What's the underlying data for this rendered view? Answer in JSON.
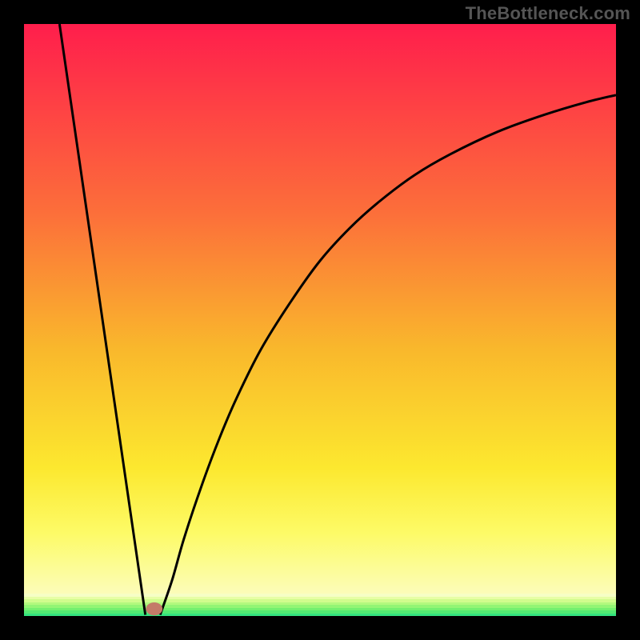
{
  "watermark": "TheBottleneck.com",
  "chart_data": {
    "type": "line",
    "title": "",
    "xlabel": "",
    "ylabel": "",
    "xlim": [
      0,
      100
    ],
    "ylim": [
      0,
      100
    ],
    "grid": false,
    "legend": false,
    "gradient_stops": [
      {
        "pos": 0,
        "color": "#FF1E4C"
      },
      {
        "pos": 32,
        "color": "#FC6F3A"
      },
      {
        "pos": 55,
        "color": "#F9B82C"
      },
      {
        "pos": 75,
        "color": "#FCE82F"
      },
      {
        "pos": 86,
        "color": "#FDFB67"
      },
      {
        "pos": 100,
        "color": "#FBFDD7"
      }
    ],
    "bottom_band_colors": [
      "#F6FEC5",
      "#E7FEA5",
      "#D1FC8D",
      "#B3F97E",
      "#93F574",
      "#73F06F",
      "#52EA73",
      "#34E37F"
    ],
    "marker": {
      "x": 22,
      "y": 1.2,
      "color": "#C47B69"
    },
    "series": [
      {
        "name": "left-segment",
        "x": [
          6,
          20.5
        ],
        "y": [
          100,
          0.2
        ]
      },
      {
        "name": "right-curve",
        "x": [
          23,
          25,
          27,
          30,
          33,
          36,
          40,
          45,
          50,
          55,
          60,
          66,
          72,
          80,
          88,
          95,
          100
        ],
        "y": [
          0.2,
          6,
          13,
          22,
          30,
          37,
          45,
          53,
          60,
          65.5,
          70,
          74.5,
          78,
          81.8,
          84.7,
          86.8,
          88
        ]
      }
    ]
  }
}
